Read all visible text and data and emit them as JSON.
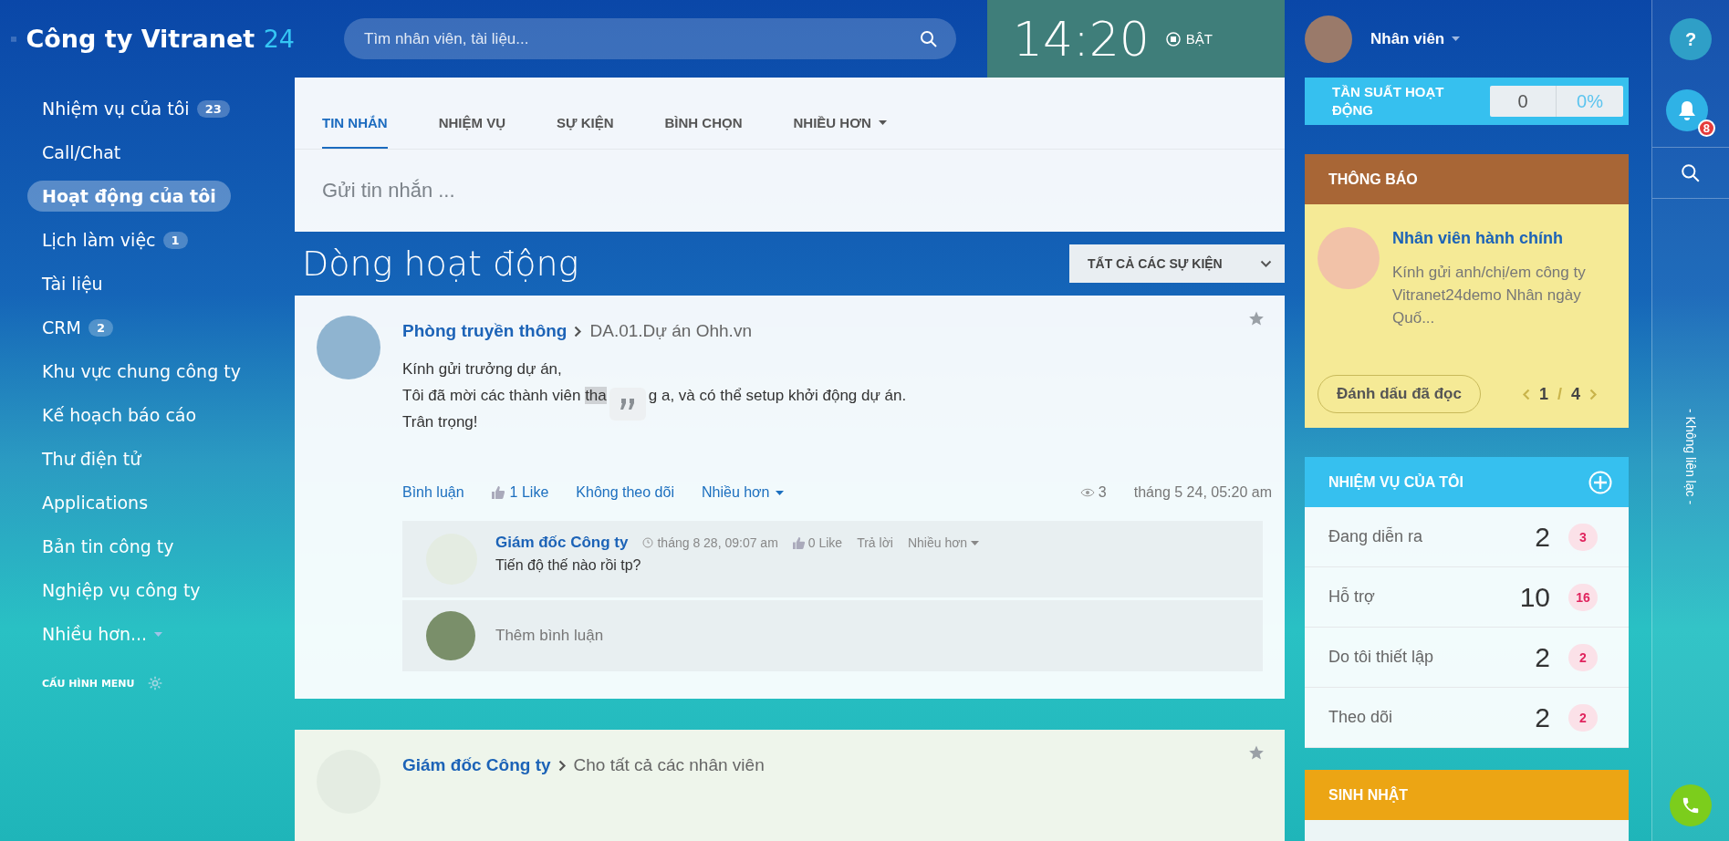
{
  "header": {
    "logo_text": "Công ty Vitranet",
    "logo_number": "24",
    "search": {
      "placeholder": "Tìm nhân viên, tài liệu..."
    },
    "clock": {
      "time": "14:20",
      "status": "BẬT"
    }
  },
  "sidebar": {
    "items": [
      {
        "label": "Nhiệm vụ của tôi",
        "count": "23",
        "selected": false,
        "dropdown": false
      },
      {
        "label": "Call/Chat",
        "selected": false,
        "dropdown": false
      },
      {
        "label": "Hoạt động của tôi",
        "selected": true,
        "dropdown": false
      },
      {
        "label": "Lịch làm việc",
        "count": "1",
        "selected": false,
        "dropdown": false
      },
      {
        "label": "Tài liệu",
        "selected": false,
        "dropdown": false
      },
      {
        "label": "CRM",
        "count": "2",
        "selected": false,
        "dropdown": false
      },
      {
        "label": "Khu vực chung công ty",
        "selected": false,
        "dropdown": false
      },
      {
        "label": "Kế hoạch báo cáo",
        "selected": false,
        "dropdown": false
      },
      {
        "label": "Thư điện tử",
        "selected": false,
        "dropdown": false
      },
      {
        "label": "Applications",
        "selected": false,
        "dropdown": false
      },
      {
        "label": "Bản tin công ty",
        "selected": false,
        "dropdown": false
      },
      {
        "label": "Nghiệp vụ công ty",
        "selected": false,
        "dropdown": false
      },
      {
        "label": "Nhiều hơn...",
        "selected": false,
        "dropdown": true
      }
    ],
    "config": "CẤU HÌNH MENU"
  },
  "composer": {
    "tabs": [
      {
        "label": "TIN NHẮN",
        "selected": true,
        "dropdown": false
      },
      {
        "label": "NHIỆM VỤ",
        "selected": false,
        "dropdown": false
      },
      {
        "label": "SỰ KIỆN",
        "selected": false,
        "dropdown": false
      },
      {
        "label": "BÌNH CHỌN",
        "selected": false,
        "dropdown": false
      },
      {
        "label": "NHIỀU HƠN",
        "selected": false,
        "dropdown": true
      }
    ],
    "placeholder": "Gửi tin nhắn ..."
  },
  "feed": {
    "title": "Dòng hoạt động",
    "filter": "TẤT CẢ CÁC SỰ KIỆN",
    "posts": [
      {
        "author": "Phòng truyền thông",
        "target": "DA.01.Dự án Ohh.vn",
        "lines": [
          {
            "before": "Kính gửi trưởng dự án,"
          },
          {
            "before": "Tôi đã mời các thành viên ",
            "selected": "tha",
            "after": "g a, và có thể setup khởi động dự án."
          },
          {
            "before": "Trân trọng!"
          }
        ],
        "actions": {
          "comment": "Bình luận",
          "like": "1 Like",
          "follow": "Không theo dõi",
          "more": "Nhiều hơn"
        },
        "views": "3",
        "date": "tháng 5 24, 05:20 am",
        "comments": [
          {
            "author": "Giám đốc Công ty",
            "date": "tháng 8 28, 09:07 am",
            "like": "0 Like",
            "reply": "Trả lời",
            "more": "Nhiều hơn",
            "text": "Tiến độ thế nào rồi tp?"
          }
        ],
        "add_comment": {
          "placeholder": "Thêm bình luận"
        }
      },
      {
        "author": "Giám đốc Công ty",
        "target": "Cho tất cả các nhân viên"
      }
    ]
  },
  "user": {
    "name": "Nhân viên"
  },
  "activity": {
    "label": "TẦN SUẤT HOẠT ĐỘNG",
    "value": "0",
    "percent": "0%"
  },
  "notice": {
    "title": "THÔNG BÁO",
    "author": "Nhân viên hành chính",
    "text": "Kính gửi anh/chị/em công ty Vitranet24demo Nhân ngày Quố...",
    "mark_read": "Đánh dấu đã đọc",
    "page": "1",
    "separator": "/",
    "pages": "4"
  },
  "tasks": {
    "title": "NHIỆM VỤ CỦA TÔI",
    "rows": [
      {
        "label": "Đang diễn ra",
        "count": "2",
        "badge": "3"
      },
      {
        "label": "Hỗ trợ",
        "count": "10",
        "badge": "16"
      },
      {
        "label": "Do tôi thiết lập",
        "count": "2",
        "badge": "2"
      },
      {
        "label": "Theo dõi",
        "count": "2",
        "badge": "2"
      }
    ]
  },
  "birthday": {
    "title": "SINH NHẬT"
  },
  "rail": {
    "help": "?",
    "notifications": "8",
    "status": "- Không liên lạc -"
  }
}
